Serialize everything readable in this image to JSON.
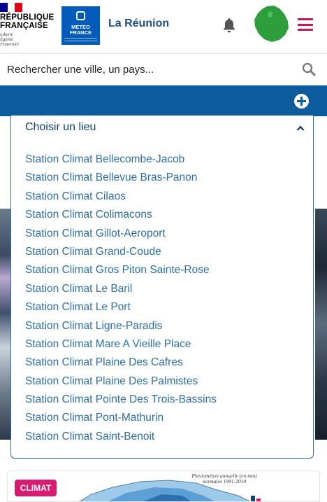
{
  "header": {
    "republic_lines": [
      "RÉPUBLIQUE",
      "FRANÇAISE"
    ],
    "motto_lines": [
      "Liberté",
      "Égalité",
      "Fraternité"
    ],
    "meteo_logo_lines": [
      "METEO",
      "FRANCE"
    ],
    "region_title": "La Réunion",
    "flag_colors": [
      "#000091",
      "#ffffff",
      "#e1000f"
    ],
    "accent_color": "#c2185b",
    "island_color": "#2e9e3c",
    "icons": {
      "bell": "bell-icon",
      "island": "reunion-island-icon",
      "menu": "hamburger-menu-icon"
    }
  },
  "search": {
    "placeholder": "Rechercher une ville, un pays...",
    "icon": "search-icon"
  },
  "location_bar": {
    "add_icon": "plus-circle-icon",
    "bar_color": "#0c5b9c"
  },
  "dropdown": {
    "title": "Choisir un lieu",
    "expanded": true,
    "items": [
      "Station Climat Bellecombe-Jacob",
      "Station Climat Bellevue Bras-Panon",
      "Station Climat Cilaos",
      "Station Climat Colimacons",
      "Station Climat Gillot-Aeroport",
      "Station Climat Grand-Coude",
      "Station Climat Gros Piton Sainte-Rose",
      "Station Climat Le Baril",
      "Station Climat Le Port",
      "Station Climat Ligne-Paradis",
      "Station Climat Mare A Vieille Place",
      "Station Climat Plaine Des Cafres",
      "Station Climat Plaine Des Palmistes",
      "Station Climat Pointe Des Trois-Bassins",
      "Station Climat Pont-Mathurin",
      "Station Climat Saint-Benoit"
    ]
  },
  "climat_card": {
    "badge": "CLIMAT",
    "map_caption_lines": [
      "Pluviométrie annuelle (en mm)",
      "normales 1991-2010"
    ],
    "badge_color": "#d81b72"
  }
}
